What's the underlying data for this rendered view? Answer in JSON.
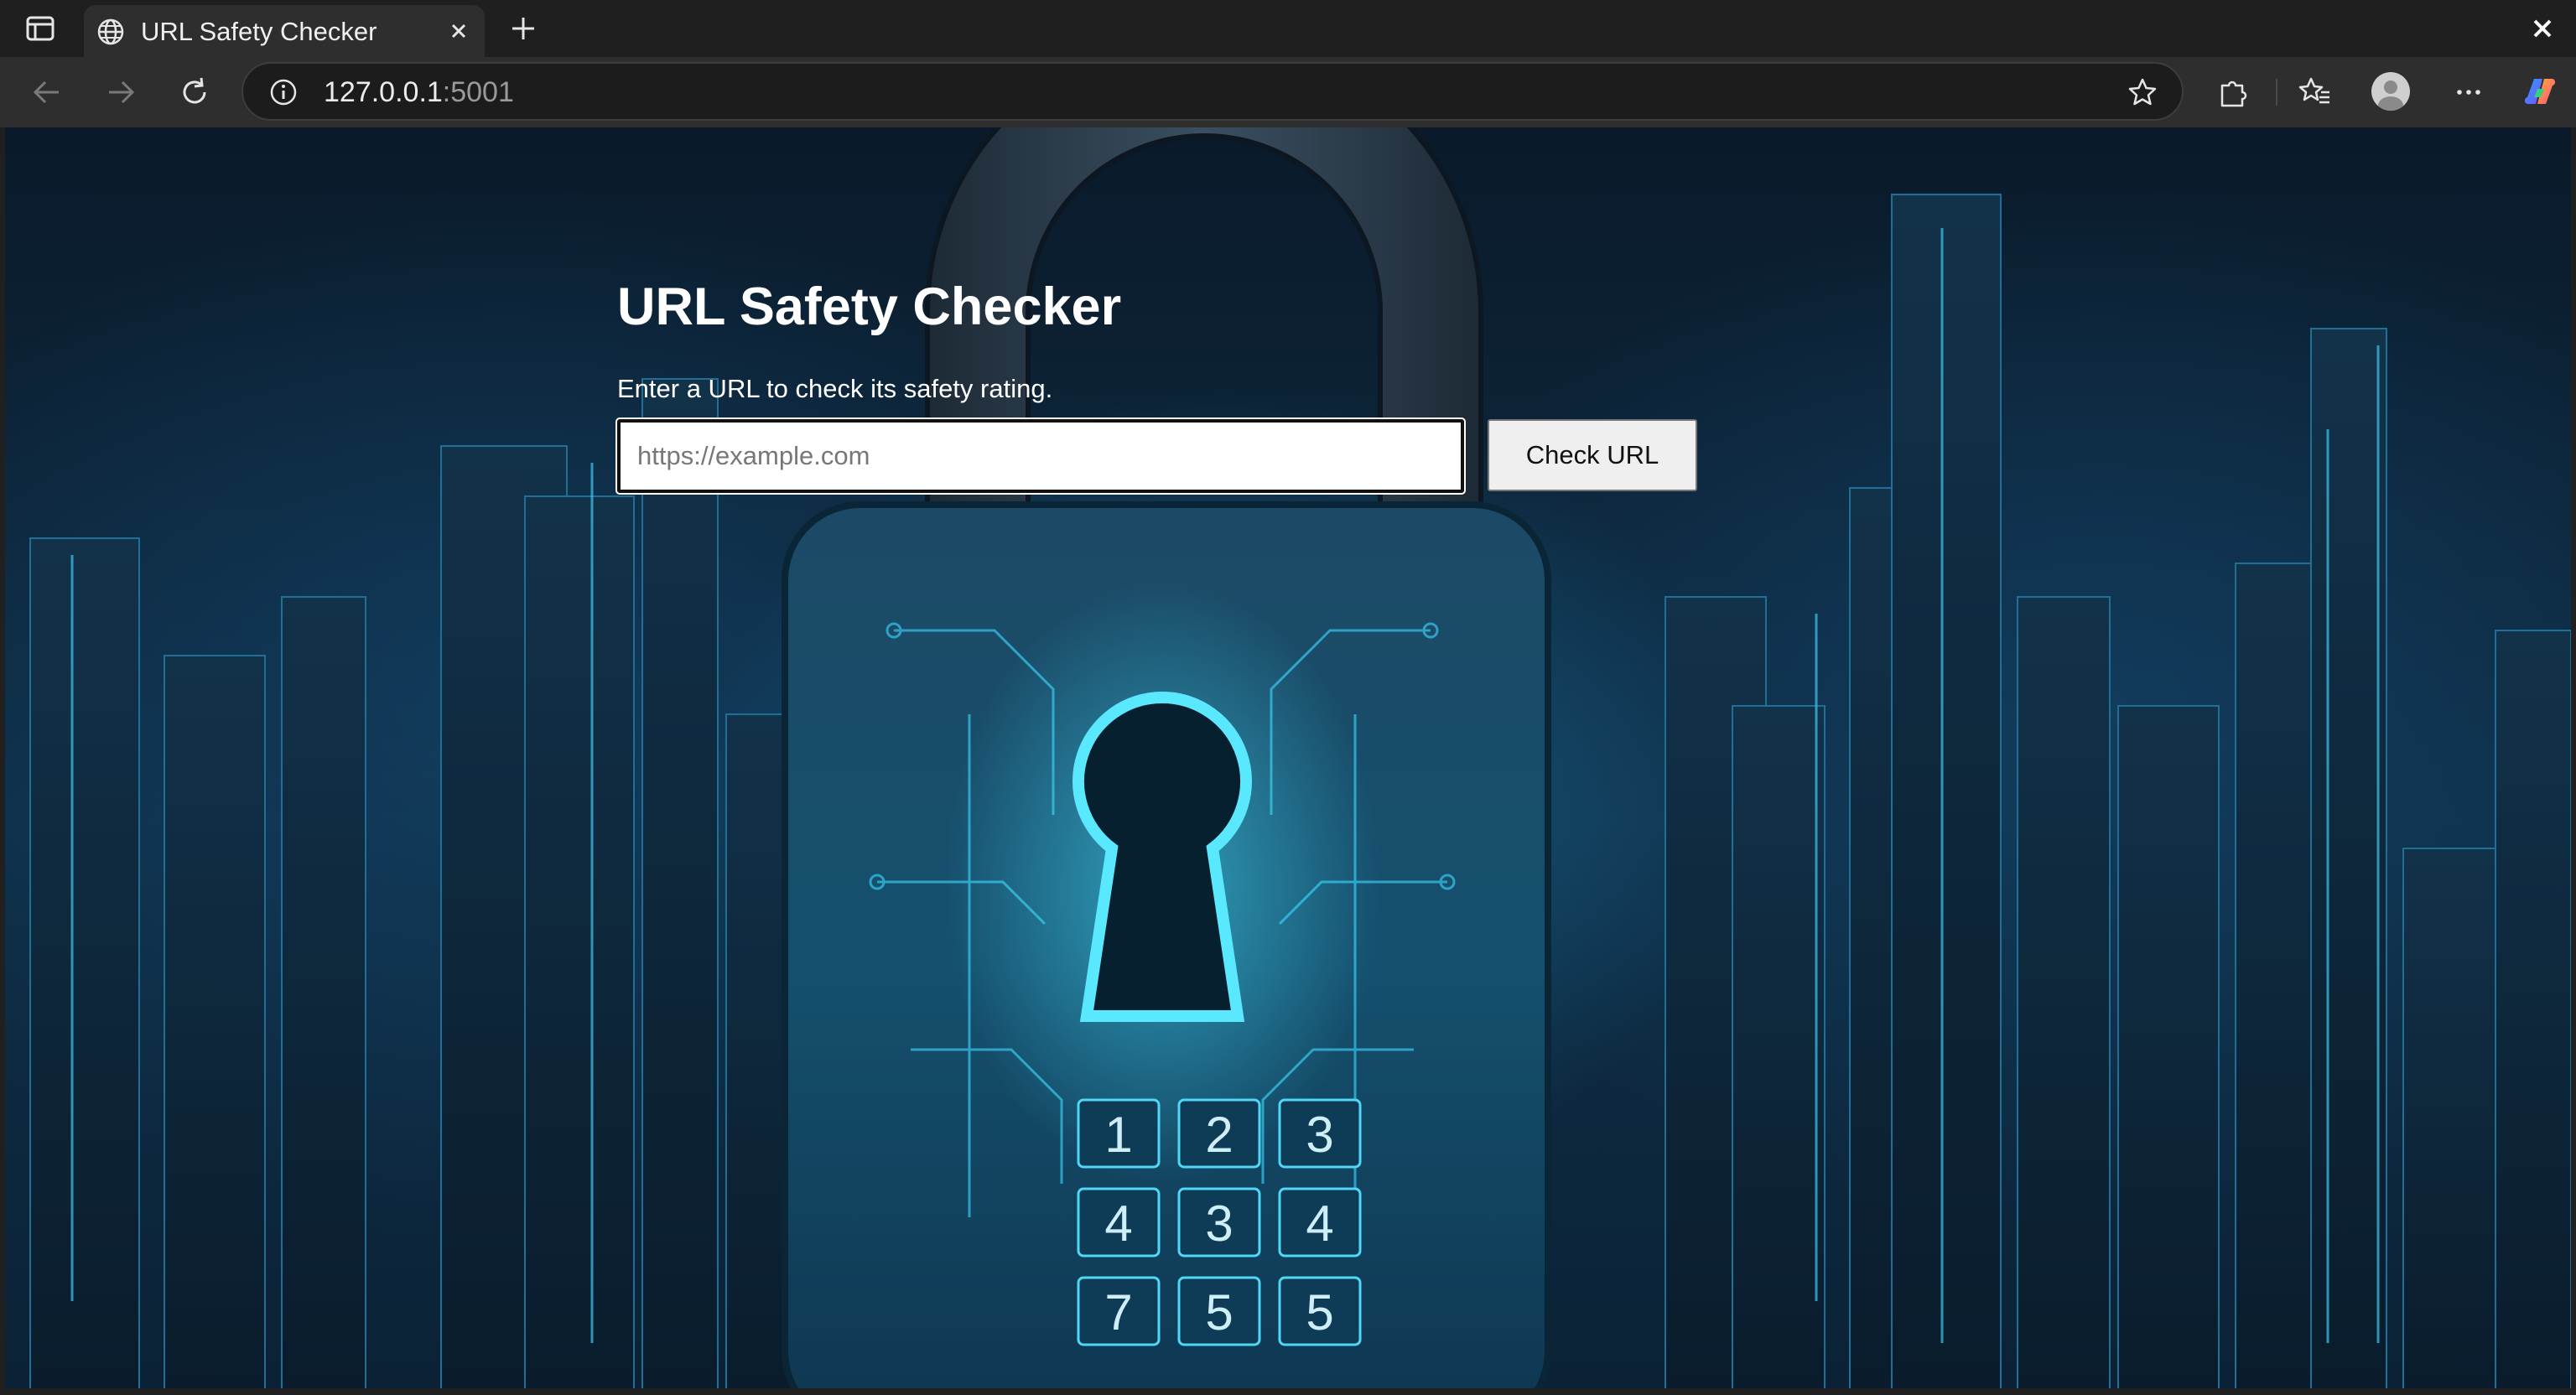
{
  "browser": {
    "tab_title": "URL Safety Checker",
    "address_host": "127.0.0.1",
    "address_port": ":5001",
    "icons": [
      "sidebar-toggle-icon",
      "globe-icon",
      "close-icon",
      "plus-icon",
      "back-icon",
      "forward-icon",
      "refresh-icon",
      "info-icon",
      "star-icon",
      "extensions-icon",
      "favorites-icon",
      "profile-icon",
      "more-icon",
      "copilot-icon"
    ]
  },
  "page": {
    "title": "URL Safety Checker",
    "subtitle": "Enter a URL to check its safety rating.",
    "url_input": {
      "placeholder": "https://example.com",
      "value": ""
    },
    "check_button": "Check URL",
    "keypad": [
      "1",
      "2",
      "3",
      "4",
      "3",
      "4",
      "7",
      "5",
      "5"
    ]
  },
  "colors": {
    "chrome_dark": "#1f1f1f",
    "toolbar": "#2e2e2e",
    "background_navy": "#0f2e46",
    "glow_cyan": "#29c7f0"
  }
}
